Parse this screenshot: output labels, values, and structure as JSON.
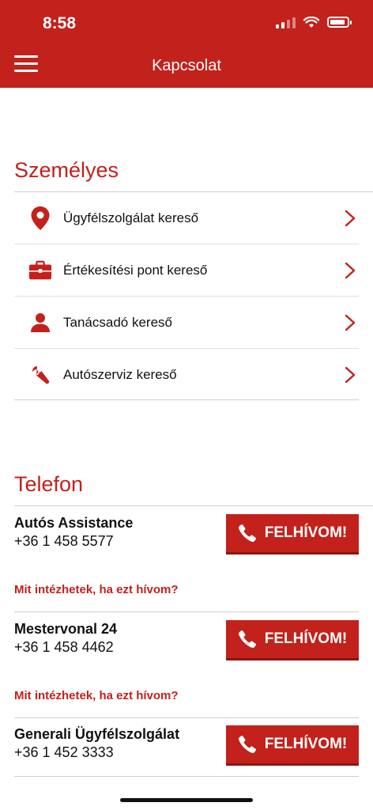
{
  "status_bar": {
    "time": "8:58"
  },
  "header": {
    "title": "Kapcsolat"
  },
  "personal": {
    "title": "Személyes",
    "items": [
      {
        "label": "Ügyfélszolgálat kereső",
        "icon": "location-pin-icon"
      },
      {
        "label": "Értékesítési pont kereső",
        "icon": "briefcase-icon"
      },
      {
        "label": "Tanácsadó kereső",
        "icon": "person-icon"
      },
      {
        "label": "Autószerviz kereső",
        "icon": "wrench-icon"
      }
    ]
  },
  "phone": {
    "title": "Telefon",
    "contacts": [
      {
        "name": "Autós Assistance",
        "number": "+36 1 458 5577",
        "button": "FELHÍVOM!",
        "faq": "Mit intézhetek, ha ezt hívom?"
      },
      {
        "name": "Mestervonal 24",
        "number": "+36 1 458 4462",
        "button": "FELHÍVOM!",
        "faq": "Mit intézhetek, ha ezt hívom?"
      },
      {
        "name": "Generali Ügyfélszolgálat",
        "number": "+36 1 452 3333",
        "button": "FELHÍVOM!"
      }
    ]
  },
  "colors": {
    "brand": "#c3211b",
    "text": "#111111",
    "divider": "#cfcfcf"
  }
}
